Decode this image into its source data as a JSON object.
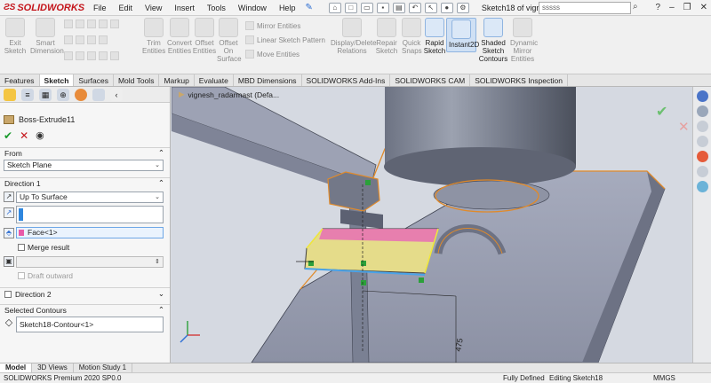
{
  "app": {
    "logo": "SOLIDWORKS",
    "menu": [
      "File",
      "Edit",
      "View",
      "Insert",
      "Tools",
      "Window",
      "Help"
    ],
    "doc_title": "Sketch18 of vignesh_...",
    "search_placeholder": "sssss"
  },
  "ribbon": {
    "exit_sketch": "Exit Sketch",
    "smart_dimension": "Smart Dimension",
    "trim_entities": "Trim Entities",
    "convert_entities": "Convert Entities",
    "offset_entities": "Offset Entities",
    "offset_on_surface": "Offset On Surface",
    "mirror_entities": "Mirror Entities",
    "linear_sketch_pattern": "Linear Sketch Pattern",
    "move_entities": "Move Entities",
    "display_delete_relations": "Display/Delete Relations",
    "repair_sketch": "Repair Sketch",
    "quick_snaps": "Quick Snaps",
    "rapid_sketch": "Rapid Sketch",
    "instant2d": "Instant2D",
    "shaded_sketch_contours": "Shaded Sketch Contours",
    "dynamic_mirror_entities": "Dynamic Mirror Entities"
  },
  "tabs": [
    "Features",
    "Sketch",
    "Surfaces",
    "Mold Tools",
    "Markup",
    "Evaluate",
    "MBD Dimensions",
    "SOLIDWORKS Add-Ins",
    "SOLIDWORKS CAM",
    "SOLIDWORKS Inspection"
  ],
  "active_tab": "Sketch",
  "panel": {
    "feature_name": "Boss-Extrude11",
    "from_label": "From",
    "from_value": "Sketch Plane",
    "direction1_label": "Direction 1",
    "end_condition": "Up To Surface",
    "face_value": "Face<1>",
    "merge_result": "Merge result",
    "draft_outward": "Draft outward",
    "direction2_label": "Direction 2",
    "selected_contours_label": "Selected Contours",
    "contour_value": "Sketch18-Contour<1>"
  },
  "viewport": {
    "tree_label": "vignesh_radarmast (Defa...",
    "dimension_value": "475"
  },
  "bottom_tabs": [
    "Model",
    "3D Views",
    "Motion Study 1"
  ],
  "status": {
    "version": "SOLIDWORKS Premium 2020 SP0.0",
    "state": "Fully Defined",
    "editing": "Editing Sketch18",
    "units": "MMGS"
  },
  "colors": {
    "accent_blue": "#2a6bd1",
    "ok_green": "#1a9b2d",
    "cancel_red": "#c4161c",
    "face_pink": "#e85aa8"
  }
}
